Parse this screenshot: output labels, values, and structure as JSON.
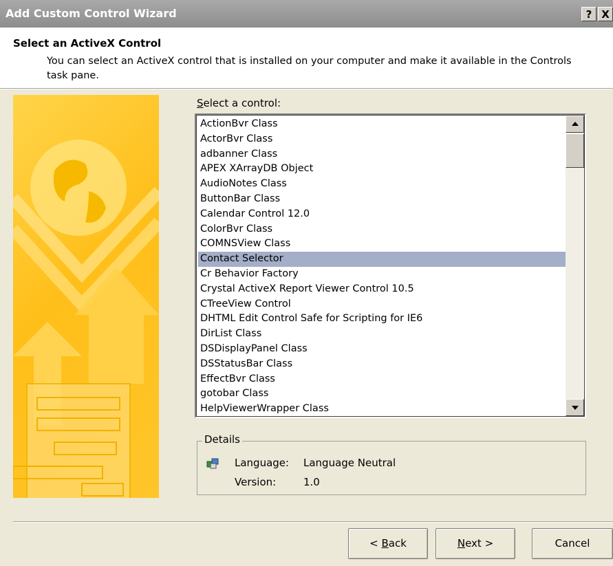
{
  "window": {
    "title": "Add Custom Control Wizard",
    "help_button": "?",
    "close_button": "X"
  },
  "header": {
    "title": "Select an ActiveX Control",
    "description": "You can select an ActiveX control that is installed on your computer and make it available in the Controls task pane."
  },
  "select": {
    "label_accel": "S",
    "label_rest": "elect a control:"
  },
  "controls": {
    "items": [
      "ActionBvr Class",
      "ActorBvr Class",
      "adbanner Class",
      "APEX XArrayDB Object",
      "AudioNotes Class",
      "ButtonBar Class",
      "Calendar Control 12.0",
      "ColorBvr Class",
      "COMNSView Class",
      "Contact Selector",
      "Cr Behavior Factory",
      "Crystal ActiveX Report Viewer Control 10.5",
      "CTreeView Control",
      "DHTML Edit Control Safe for Scripting for IE6",
      "DirList Class",
      "DSDisplayPanel Class",
      "DSStatusBar Class",
      "EffectBvr Class",
      "gotobar Class",
      "HelpViewerWrapper Class"
    ],
    "selected": "Contact Selector"
  },
  "details": {
    "legend": "Details",
    "language_label": "Language:",
    "language_value": "Language Neutral",
    "version_label": "Version:",
    "version_value": "1.0"
  },
  "buttons": {
    "back_accel": "B",
    "back_prefix": "< ",
    "back_rest": "ack",
    "next_accel": "N",
    "next_rest": "ext >",
    "cancel": "Cancel"
  },
  "colors": {
    "selection": "#a3aec8",
    "banner": "#ffc52a",
    "titlebar": "#9a9a9a"
  }
}
